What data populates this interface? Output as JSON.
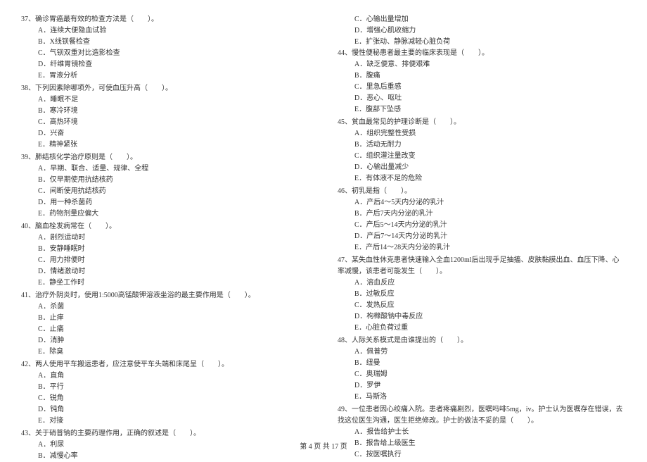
{
  "left_column": [
    {
      "number": "37",
      "text": "、确诊胃癌最有效的检查方法是（　　）。",
      "options": [
        "A．连续大便隐血试验",
        "B．X线钡餐检查",
        "C．气钡双重对比造影检查",
        "D．纤维胃镜检查",
        "E．胃液分析"
      ]
    },
    {
      "number": "38",
      "text": "、下列因素除哪项外，可使血压升高（　　）。",
      "options": [
        "A．睡眠不足",
        "B．寒冷环境",
        "C．高热环境",
        "D．兴奋",
        "E．精神紧张"
      ]
    },
    {
      "number": "39",
      "text": "、肺结核化学治疗原则是（　　）。",
      "options": [
        "A．早期、联合、适量、规律、全程",
        "B．仅早期使用抗结核药",
        "C．间断使用抗结核药",
        "D．用一种杀菌药",
        "E．药物剂量应偏大"
      ]
    },
    {
      "number": "40",
      "text": "、脑血栓发病常在（　　）。",
      "options": [
        "A．剧烈运动时",
        "B．安静睡眠时",
        "C．用力排便时",
        "D．情绪激动时",
        "E．静坐工作时"
      ]
    },
    {
      "number": "41",
      "text": "、治疗外阴炎时，使用1:5000高锰酸钾溶液坐浴的最主要作用是（　　）。",
      "options": [
        "A．杀菌",
        "B．止痒",
        "C．止痛",
        "D．消肿",
        "E．除臭"
      ]
    },
    {
      "number": "42",
      "text": "、两人使用平车搬运患者，应注意使平车头端和床尾呈（　　）。",
      "options": [
        "A．直角",
        "B．平行",
        "C．锐角",
        "D．钝角",
        "E．对接"
      ]
    },
    {
      "number": "43",
      "text": "、关于硝普钠的主要药理作用，正确的叙述是（　　）。",
      "options": [
        "A．利尿",
        "B．减慢心率"
      ]
    }
  ],
  "right_column_prefix_options": [
    "C．心输出量增加",
    "D．增强心肌收缩力",
    "E．扩张动、静脉减轻心脏负荷"
  ],
  "right_column": [
    {
      "number": "44",
      "text": "、慢性便秘患者最主要的临床表现是（　　）。",
      "options": [
        "A．缺乏便意、排便艰难",
        "B．腹痛",
        "C．里急后重感",
        "D．恶心、呕吐",
        "E．腹部下坠感"
      ]
    },
    {
      "number": "45",
      "text": "、贫血最常见的护理诊断是（　　）。",
      "options": [
        "A．组织完整性受损",
        "B．活动无耐力",
        "C．组织灌注量改变",
        "D．心输出量减少",
        "E．有体液不足的危险"
      ]
    },
    {
      "number": "46",
      "text": "、初乳是指（　　）。",
      "options": [
        "A．产后4～5天内分泌的乳汁",
        "B．产后7天内分泌的乳汁",
        "C．产后5～14天内分泌的乳汁",
        "D．产后7～14天内分泌的乳汁",
        "E．产后14～28天内分泌的乳汁"
      ]
    },
    {
      "number": "47",
      "text": "、某失血性休克患者快速输入全血1200ml后出现手足抽搐、皮肤黏膜出血、血压下降、心率减慢，该患者可能发生（　　）。",
      "options": [
        "A．溶血反应",
        "B．过敏反应",
        "C．发热反应",
        "D．枸橼酸钠中毒反应",
        "E．心脏负荷过重"
      ]
    },
    {
      "number": "48",
      "text": "、人际关系模式是由谁提出的（　　）。",
      "options": [
        "A．佩普劳",
        "B．纽曼",
        "C．奥瑞姆",
        "D．罗伊",
        "E．马斯洛"
      ]
    },
    {
      "number": "49",
      "text": "、一位患者因心绞痛入院。患者疼痛剧烈，医嘱吗啡5mg，iv。护士认为医嘱存在错误，去找这位医生沟通，医生拒绝修改。护士的做法不妥的是（　　）。",
      "options": [
        "A．报告给护士长",
        "B．报告给上级医生",
        "C．按医嘱执行"
      ]
    }
  ],
  "footer": "第 4 页 共 17 页"
}
